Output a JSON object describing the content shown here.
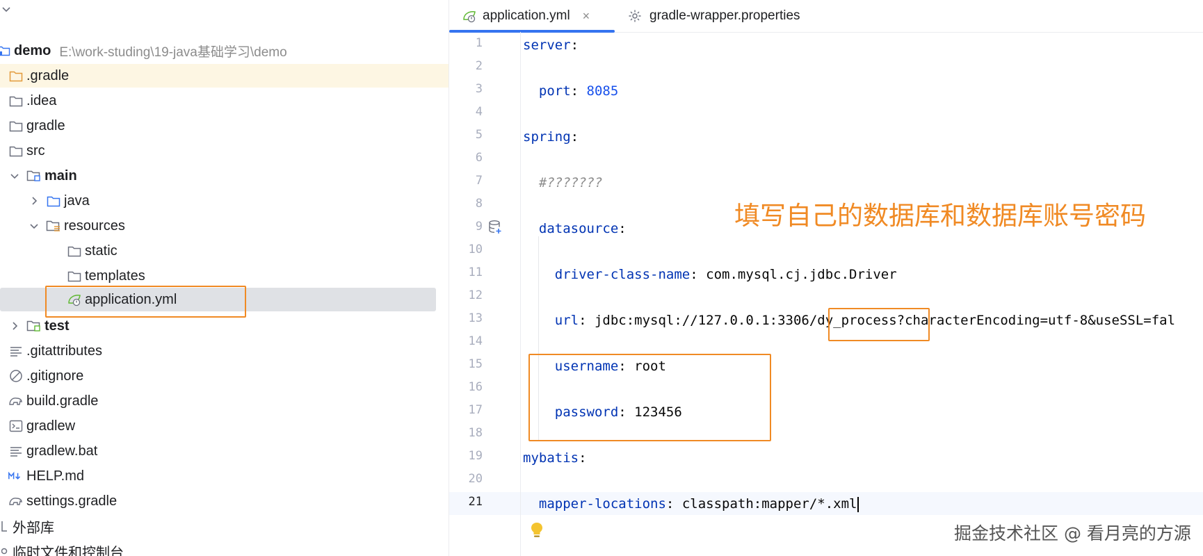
{
  "project_tree": {
    "root": {
      "name": "demo",
      "path": "E:\\work-studing\\19-java基础学习\\demo"
    },
    "items": [
      {
        "label": ".gradle"
      },
      {
        "label": ".idea"
      },
      {
        "label": "gradle"
      },
      {
        "label": "src"
      },
      {
        "label": "main"
      },
      {
        "label": "java"
      },
      {
        "label": "resources"
      },
      {
        "label": "static"
      },
      {
        "label": "templates"
      },
      {
        "label": "application.yml"
      },
      {
        "label": "test"
      },
      {
        "label": ".gitattributes"
      },
      {
        "label": ".gitignore"
      },
      {
        "label": "build.gradle"
      },
      {
        "label": "gradlew"
      },
      {
        "label": "gradlew.bat"
      },
      {
        "label": "HELP.md"
      },
      {
        "label": "settings.gradle"
      },
      {
        "label": "外部库"
      },
      {
        "label": "临时文件和控制台"
      }
    ]
  },
  "editor": {
    "tabs": [
      {
        "label": "application.yml",
        "close": "×",
        "active": true
      },
      {
        "label": "gradle-wrapper.properties",
        "active": false
      }
    ],
    "line_numbers": [
      "1",
      "2",
      "3",
      "4",
      "5",
      "6",
      "7",
      "8",
      "9",
      "10",
      "11",
      "12",
      "13",
      "14",
      "15",
      "16",
      "17",
      "18",
      "19",
      "20",
      "21"
    ],
    "current_line": "21",
    "code": {
      "l1_key": "server",
      "l1_colon": ":",
      "l3_key": "port",
      "l3_colon": ": ",
      "l3_val": "8085",
      "l5_key": "spring",
      "l5_colon": ":",
      "l7_comment": "#???????",
      "l9_key": "datasource",
      "l9_colon": ":",
      "l11_key": "driver-class-name",
      "l11_colon": ": ",
      "l11_val": "com.mysql.cj.jdbc.Driver",
      "l13_key": "url",
      "l13_colon": ": ",
      "l13_val": "jdbc:mysql://127.0.0.1:3306/dy_process?characterEncoding=utf-8&useSSL=fal",
      "l15_key": "username",
      "l15_colon": ": ",
      "l15_val": "root",
      "l17_key": "password",
      "l17_colon": ": ",
      "l17_val": "123456",
      "l19_key": "mybatis",
      "l19_colon": ":",
      "l21_key": "mapper-locations",
      "l21_colon": ": ",
      "l21_val": "classpath:mapper/*.xml"
    }
  },
  "annotation": {
    "text": "填写自己的数据库和数据库账号密码",
    "color": "#f08a24"
  },
  "watermark": "掘金技术社区 @ 看月亮的方源",
  "colors": {
    "accent": "#3574f0",
    "selection": "#dfe1e5",
    "highlight": "#fdf6e3",
    "annotation": "#f08a24"
  }
}
